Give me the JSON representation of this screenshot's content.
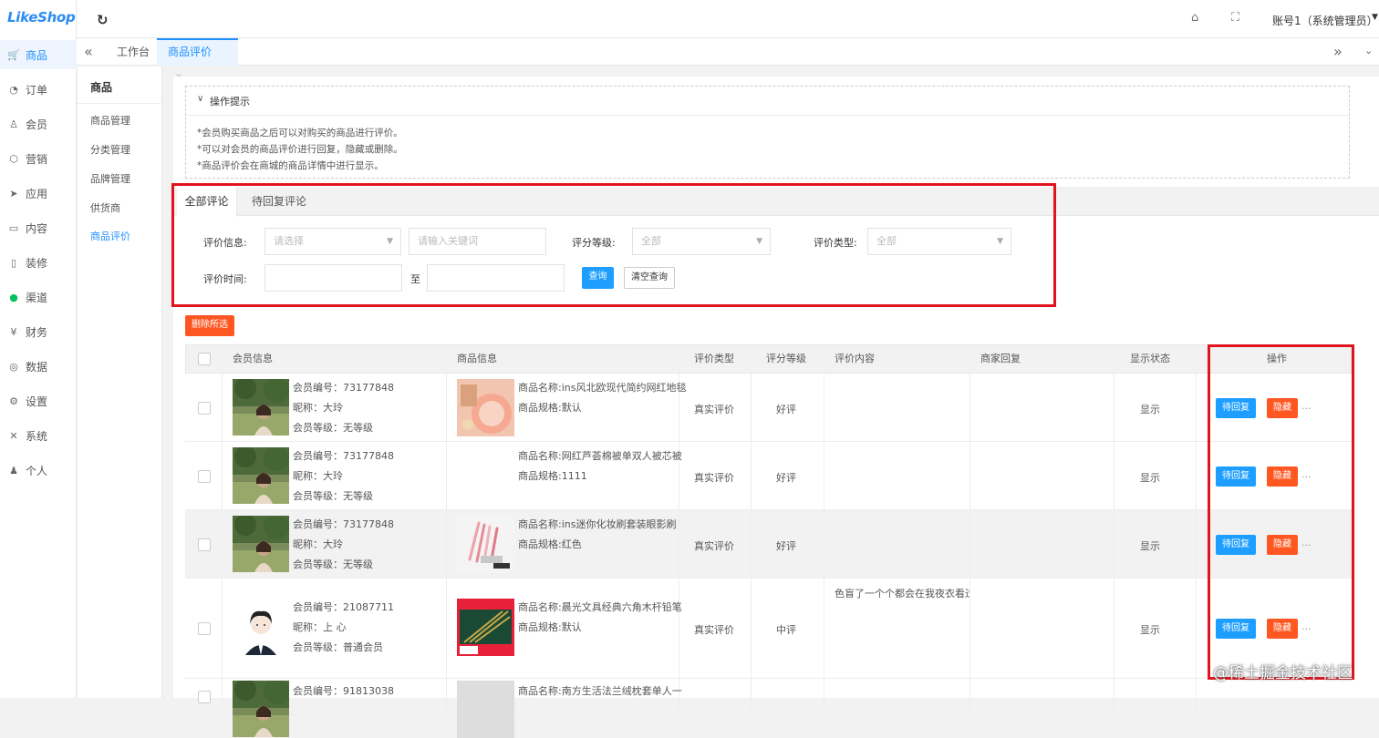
{
  "app": {
    "logo": "LikeShop"
  },
  "rail": [
    {
      "label": "商品",
      "icon": "cart-icon",
      "glyph": "🛒"
    },
    {
      "label": "订单",
      "icon": "bell-icon",
      "glyph": "◔"
    },
    {
      "label": "会员",
      "icon": "user-icon",
      "glyph": "♙"
    },
    {
      "label": "营销",
      "icon": "cube-icon",
      "glyph": "⬡"
    },
    {
      "label": "应用",
      "icon": "send-icon",
      "glyph": "➤"
    },
    {
      "label": "内容",
      "icon": "content-icon",
      "glyph": "▭"
    },
    {
      "label": "装修",
      "icon": "phone-icon",
      "glyph": "▯"
    },
    {
      "label": "渠道",
      "icon": "wechat-icon",
      "glyph": "●"
    },
    {
      "label": "财务",
      "icon": "yen-icon",
      "glyph": "¥"
    },
    {
      "label": "数据",
      "icon": "globe-icon",
      "glyph": "◎"
    },
    {
      "label": "设置",
      "icon": "gear-icon",
      "glyph": "⚙"
    },
    {
      "label": "系统",
      "icon": "tools-icon",
      "glyph": "✕"
    },
    {
      "label": "个人",
      "icon": "person-icon",
      "glyph": "♟"
    }
  ],
  "topbar": {
    "account": "账号1（系统管理员）"
  },
  "tabs": [
    {
      "label": "工作台"
    },
    {
      "label": "商品评价",
      "close": "×"
    }
  ],
  "submenu": {
    "title": "商品",
    "items": [
      "商品管理",
      "分类管理",
      "品牌管理",
      "供货商",
      "商品评价"
    ]
  },
  "tips": {
    "title": "操作提示",
    "lines": [
      "*会员购买商品之后可以对购买的商品进行评价。",
      "*可以对会员的商品评价进行回复，隐藏或删除。",
      "*商品评价会在商城的商品详情中进行显示。"
    ]
  },
  "filter": {
    "tabs": [
      "全部评论",
      "待回复评论"
    ],
    "info_label": "评价信息:",
    "info_select_placeholder": "请选择",
    "info_input_placeholder": "请输入关键词",
    "level_label": "评分等级:",
    "level_value": "全部",
    "type_label": "评价类型:",
    "type_value": "全部",
    "time_label": "评价时间:",
    "time_sep": "至",
    "search_btn": "查询",
    "clear_btn": "清空查询"
  },
  "delete_selected": "删除所选",
  "table": {
    "headers": [
      "会员信息",
      "商品信息",
      "评价类型",
      "评分等级",
      "评价内容",
      "商家回复",
      "显示状态",
      "操作"
    ],
    "rows": [
      {
        "member_no": "会员编号：73177848",
        "nickname": "昵称：大玲",
        "level": "会员等级：无等级",
        "goods_name": "商品名称:ins风北欧现代简约网红地毯",
        "goods_spec": "商品规格:默认",
        "type": "真实评价",
        "grade": "好评",
        "content": "",
        "reply": "",
        "status": "显示",
        "reply_btn": "待回复",
        "hide_btn": "隐藏",
        "more": "..."
      },
      {
        "member_no": "会员编号：73177848",
        "nickname": "昵称：大玲",
        "level": "会员等级：无等级",
        "goods_name": "商品名称:网红芦荟棉被单双人被芯被",
        "goods_spec": "商品规格:1111",
        "type": "真实评价",
        "grade": "好评",
        "content": "",
        "reply": "",
        "status": "显示",
        "reply_btn": "待回复",
        "hide_btn": "隐藏",
        "more": "..."
      },
      {
        "member_no": "会员编号：73177848",
        "nickname": "昵称：大玲",
        "level": "会员等级：无等级",
        "goods_name": "商品名称:ins迷你化妆刷套装眼影刷",
        "goods_spec": "商品规格:红色",
        "type": "真实评价",
        "grade": "好评",
        "content": "",
        "reply": "",
        "status": "显示",
        "reply_btn": "待回复",
        "hide_btn": "隐藏",
        "more": "..."
      },
      {
        "member_no": "会员编号：21087711",
        "nickname": "昵称：上 心",
        "level": "会员等级：普通会员",
        "goods_name": "商品名称:晨光文具经典六角木杆铅笔",
        "goods_spec": "商品规格:默认",
        "type": "真实评价",
        "grade": "中评",
        "content": "色盲了一个个都会在我夜衣看过",
        "reply": "",
        "status": "显示",
        "reply_btn": "待回复",
        "hide_btn": "隐藏",
        "more": "..."
      },
      {
        "member_no": "会员编号：91813038",
        "nickname": "",
        "level": "",
        "goods_name": "商品名称:南方生活法兰绒枕套单人一",
        "goods_spec": "",
        "type": "",
        "grade": "",
        "content": "",
        "reply": "",
        "status": "",
        "reply_btn": "",
        "hide_btn": "",
        "more": ""
      }
    ]
  },
  "watermark": "@稀土掘金技术社区"
}
